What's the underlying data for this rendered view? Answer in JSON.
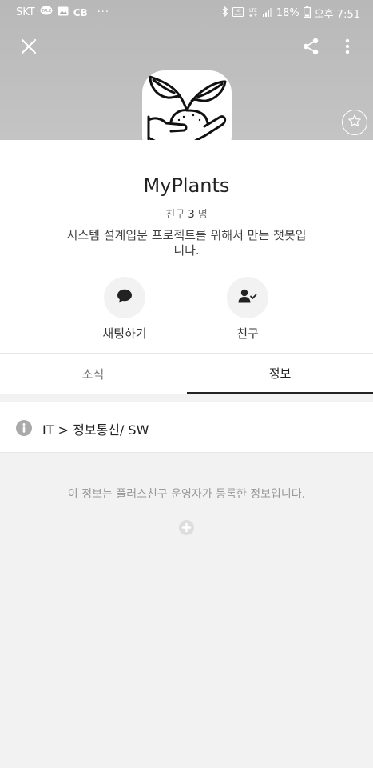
{
  "status_bar": {
    "carrier": "SKT",
    "icons_left": [
      "talk-icon",
      "gallery-icon",
      "cb-text"
    ],
    "cb_label": "CB",
    "more": "···",
    "battery": "18%",
    "time": "오후 7:51"
  },
  "header": {
    "close_icon": "close-icon",
    "share_icon": "share-icon",
    "menu_icon": "more-vertical-icon"
  },
  "profile": {
    "name": "MyPlants",
    "friends_label": "친구",
    "friends_count": "3",
    "friends_unit": "명",
    "description": "시스템 설계입문 프로젝트를 위해서 만든 챗봇입니다."
  },
  "actions": {
    "chat_label": "채팅하기",
    "friend_label": "친구"
  },
  "tabs": {
    "news": "소식",
    "info": "정보"
  },
  "info": {
    "category": "IT > 정보통신/ SW",
    "notice": "이 정보는 플러스친구 운영자가 등록한 정보입니다."
  }
}
